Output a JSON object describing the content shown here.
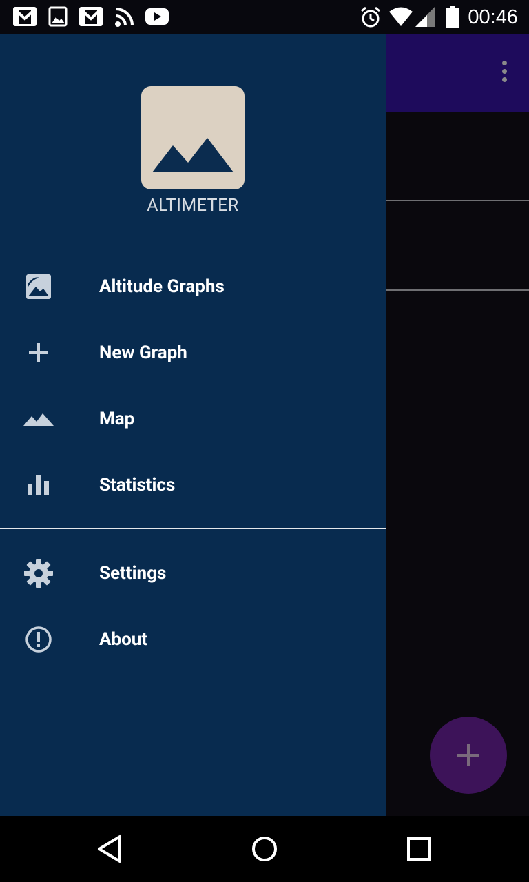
{
  "status_bar": {
    "time": "00:46",
    "icons_left": [
      "gmail-icon",
      "image-icon",
      "gmail-icon",
      "rss-icon",
      "youtube-icon"
    ],
    "icons_right": [
      "alarm-icon",
      "wifi-icon",
      "signal-icon",
      "battery-icon"
    ]
  },
  "drawer": {
    "header": {
      "app_name": "ALTIMETER",
      "logo": "mountain-logo"
    },
    "items": [
      {
        "label": "Altitude Graphs",
        "icon": "image-icon"
      },
      {
        "label": "New Graph",
        "icon": "plus-icon"
      },
      {
        "label": "Map",
        "icon": "mountain-icon"
      },
      {
        "label": "Statistics",
        "icon": "bar-chart-icon"
      }
    ],
    "secondary_items": [
      {
        "label": "Settings",
        "icon": "gear-icon"
      },
      {
        "label": "About",
        "icon": "info-icon"
      }
    ]
  },
  "app": {
    "toolbar_color": "#1e0b5c",
    "fab_icon": "plus-icon"
  },
  "colors": {
    "drawer_bg": "#082b4f",
    "logo_bg": "#dcd1c2",
    "accent_dark": "#0b2c4f"
  }
}
